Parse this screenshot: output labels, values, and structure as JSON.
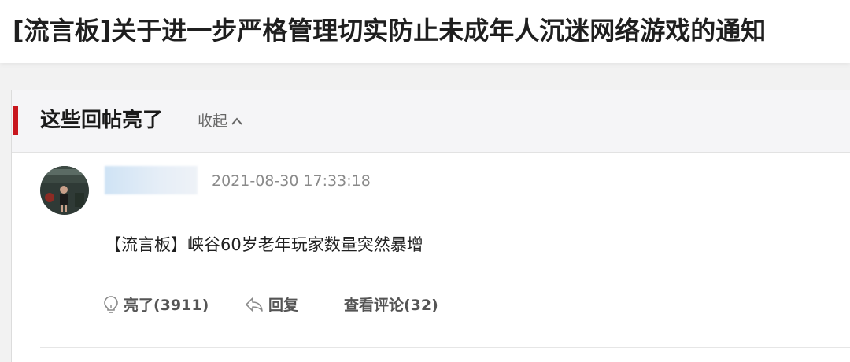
{
  "header": {
    "title": "[流言板]关于进一步严格管理切实防止未成年人沉迷网络游戏的通知"
  },
  "section": {
    "title": "这些回帖亮了",
    "collapse_label": "收起",
    "accent_color": "#c8161d"
  },
  "post": {
    "username": "",
    "timestamp": "2021-08-30 17:33:18",
    "content": "【流言板】峡谷60岁老年玩家数量突然暴增",
    "actions": {
      "light_label": "亮了(3911)",
      "reply_label": "回复",
      "comments_label": "查看评论(32)"
    }
  },
  "icons": {
    "light": "lightbulb-icon",
    "reply": "reply-arrow-icon",
    "collapse": "chevron-up-icon"
  }
}
